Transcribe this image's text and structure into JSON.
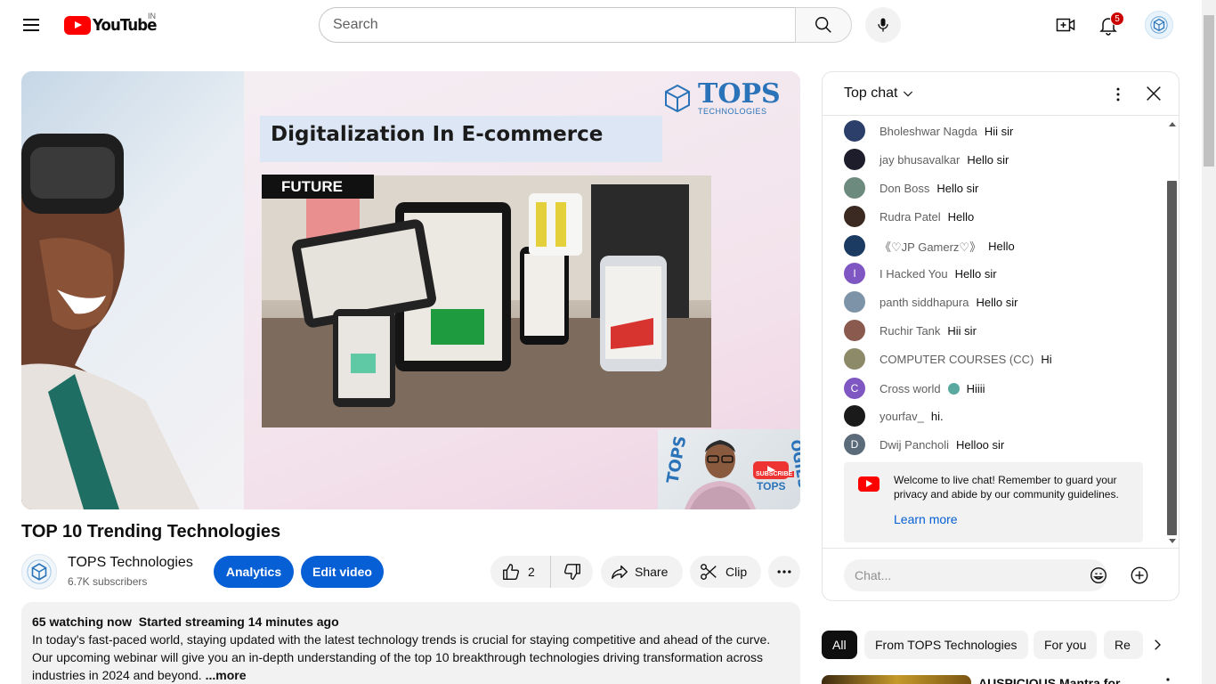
{
  "header": {
    "logo_text": "YouTube",
    "country_code": "IN",
    "search_placeholder": "Search",
    "notification_count": "5"
  },
  "player": {
    "slide_brand": "TOPS",
    "slide_brand_sub": "TECHNOLOGIES",
    "slide_title": "Digitalization In E-commerce",
    "slide_tag": "FUTURE",
    "webcam_sub": "SUBSCRIBE",
    "webcam_brand": "TOPS"
  },
  "video": {
    "title": "TOP 10 Trending Technologies",
    "channel_name": "TOPS Technologies",
    "subscribers": "6.7K subscribers",
    "analytics_label": "Analytics",
    "edit_label": "Edit video",
    "like_count": "2",
    "share_label": "Share",
    "clip_label": "Clip"
  },
  "description": {
    "watching": "65 watching now",
    "started": "Started streaming 14 minutes ago",
    "text": "In today's fast-paced world, staying updated with the latest technology trends is crucial for staying competitive and ahead of the curve. Our upcoming webinar will give you an in-depth understanding of the top 10 breakthrough technologies driving transformation across industries in 2024 and beyond.",
    "more": "...more"
  },
  "chat": {
    "title": "Top chat",
    "messages": [
      {
        "author": "Bholeshwar Nagda",
        "text": "Hii sir",
        "initial": "",
        "color": "#2b3f6a"
      },
      {
        "author": "jay bhusavalkar",
        "text": "Hello sir",
        "initial": "",
        "color": "#1d1d2b"
      },
      {
        "author": "Don Boss",
        "text": "Hello sir",
        "initial": "",
        "color": "#6c8a7e"
      },
      {
        "author": "Rudra Patel",
        "text": "Hello",
        "initial": "",
        "color": "#3a2a22"
      },
      {
        "author": "《♡JP Gamerz♡》",
        "text": "Hello",
        "initial": "",
        "color": "#1b3b63"
      },
      {
        "author": "I Hacked You",
        "text": "Hello sir",
        "initial": "I",
        "color": "#7e57c2"
      },
      {
        "author": "panth siddhapura",
        "text": "Hello sir",
        "initial": "",
        "color": "#7d93a8"
      },
      {
        "author": "Ruchir Tank",
        "text": "Hii sir",
        "initial": "",
        "color": "#8a5a4e"
      },
      {
        "author": "COMPUTER COURSES (CC)",
        "text": "Hi",
        "initial": "",
        "color": "#8d8a6a"
      },
      {
        "author": "Cross world",
        "text": "Hiiii",
        "initial": "C",
        "color": "#7e57c2"
      },
      {
        "author": "yourfav_",
        "text": "hi.",
        "initial": "",
        "color": "#1a1a1a"
      },
      {
        "author": "Dwij Pancholi",
        "text": "Helloo sir",
        "initial": "D",
        "color": "#5c6b7a"
      }
    ],
    "welcome_text": "Welcome to live chat! Remember to guard your privacy and abide by our community guidelines.",
    "learn_more": "Learn more",
    "input_placeholder": "Chat..."
  },
  "chips": [
    "All",
    "From TOPS Technologies",
    "For you",
    "Re"
  ],
  "recommendation": {
    "title": "AUSPICIOUS Mantra for"
  },
  "colors": {
    "brand_red": "#ff0000",
    "accent_blue": "#065fd4",
    "badge_red": "#cc0000"
  }
}
